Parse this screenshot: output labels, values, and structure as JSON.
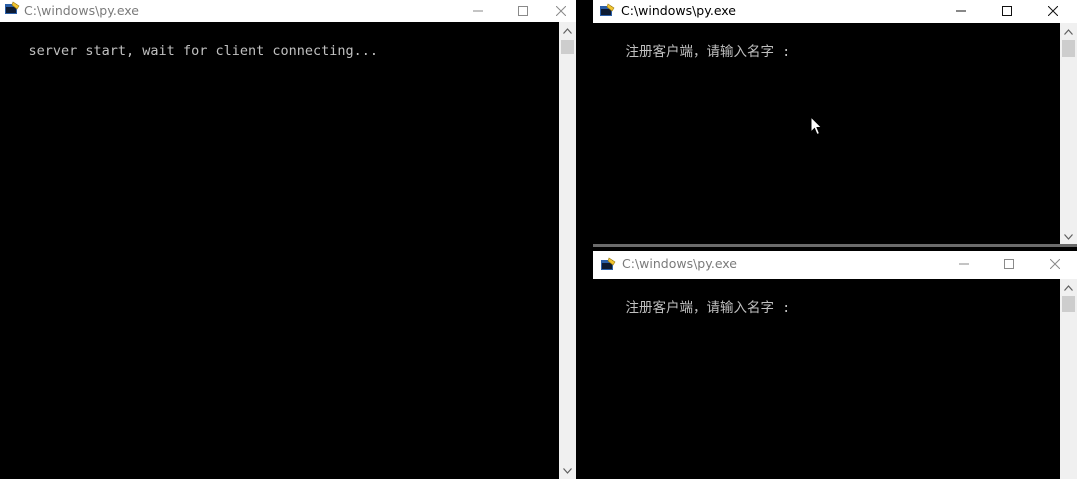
{
  "windows": {
    "server": {
      "title": "C:\\windows\\py.exe",
      "output": "server start, wait for client connecting..."
    },
    "client1": {
      "title": "C:\\windows\\py.exe",
      "output": "注册客户端，请输入名字 :"
    },
    "client2": {
      "title": "C:\\windows\\py.exe",
      "output": "注册客户端，请输入名字 :"
    }
  },
  "icons": {
    "app": "console-app-icon",
    "minimize": "minimize-icon",
    "maximize": "maximize-icon",
    "close": "close-icon",
    "scroll_up": "chevron-up-icon",
    "scroll_down": "chevron-down-icon",
    "cursor": "mouse-pointer-icon"
  },
  "colors": {
    "console_bg": "#000000",
    "console_text": "#c0c0c0",
    "titlebar_bg": "#ffffff",
    "inactive_title": "#7a7a7a"
  }
}
